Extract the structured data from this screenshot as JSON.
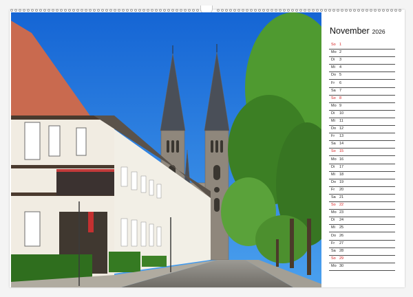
{
  "calendar": {
    "month": "November",
    "year": "2026",
    "days": [
      {
        "wd": "So",
        "d": "1",
        "sunday": true
      },
      {
        "wd": "Mo",
        "d": "2"
      },
      {
        "wd": "Di",
        "d": "3"
      },
      {
        "wd": "Mi",
        "d": "4"
      },
      {
        "wd": "Do",
        "d": "5"
      },
      {
        "wd": "Fr",
        "d": "6"
      },
      {
        "wd": "Sa",
        "d": "7"
      },
      {
        "wd": "So",
        "d": "8",
        "sunday": true
      },
      {
        "wd": "Mo",
        "d": "9"
      },
      {
        "wd": "Di",
        "d": "10"
      },
      {
        "wd": "Mi",
        "d": "11"
      },
      {
        "wd": "Do",
        "d": "12"
      },
      {
        "wd": "Fr",
        "d": "13"
      },
      {
        "wd": "Sa",
        "d": "14"
      },
      {
        "wd": "So",
        "d": "15",
        "sunday": true
      },
      {
        "wd": "Mo",
        "d": "16"
      },
      {
        "wd": "Di",
        "d": "17"
      },
      {
        "wd": "Mi",
        "d": "18"
      },
      {
        "wd": "Do",
        "d": "19"
      },
      {
        "wd": "Fr",
        "d": "20"
      },
      {
        "wd": "Sa",
        "d": "21"
      },
      {
        "wd": "So",
        "d": "22",
        "sunday": true
      },
      {
        "wd": "Mo",
        "d": "23"
      },
      {
        "wd": "Di",
        "d": "24"
      },
      {
        "wd": "Mi",
        "d": "25"
      },
      {
        "wd": "Do",
        "d": "26"
      },
      {
        "wd": "Fr",
        "d": "27"
      },
      {
        "wd": "Sa",
        "d": "28"
      },
      {
        "wd": "So",
        "d": "29",
        "sunday": true
      },
      {
        "wd": "Mo",
        "d": "30"
      }
    ]
  },
  "colors": {
    "sunday": "#d62020",
    "text": "#222222",
    "sky": "#1f7de0",
    "foliage": "#3f8a2a"
  },
  "icons": [
    "spiral-binding-icon",
    "hanger-hole-icon"
  ]
}
